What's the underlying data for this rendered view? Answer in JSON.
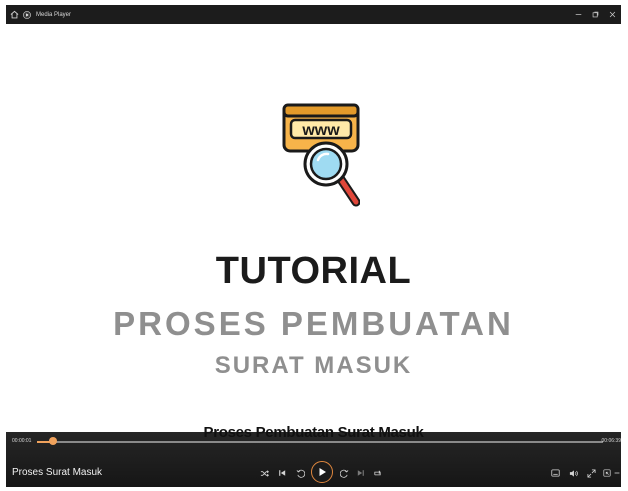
{
  "window": {
    "title": "Media Player"
  },
  "video": {
    "logo_text": "www",
    "title_line1": "TUTORIAL",
    "title_line2": "PROSES PEMBUATAN",
    "title_line3": "SURAT MASUK",
    "caption": "Proses Pembuatan Surat Masuk"
  },
  "player": {
    "current_time": "00:00:01",
    "duration": "00:06:39",
    "progress_fraction": 0.003,
    "media_title": "Proses Surat Masuk",
    "accent_color": "#f0a25c"
  },
  "icons": {
    "home": "home-icon",
    "app": "media-player-app-icon",
    "shuffle": "shuffle-icon",
    "previous": "skip-previous-icon",
    "back": "skip-back-10-icon",
    "play": "play-icon",
    "forward": "skip-forward-30-icon",
    "next": "skip-next-icon",
    "repeat": "repeat-icon",
    "subtitles": "subtitles-icon",
    "volume": "volume-icon",
    "fullscreen": "full-screen-icon",
    "miniplayer": "mini-player-icon",
    "more": "more-options-icon"
  }
}
